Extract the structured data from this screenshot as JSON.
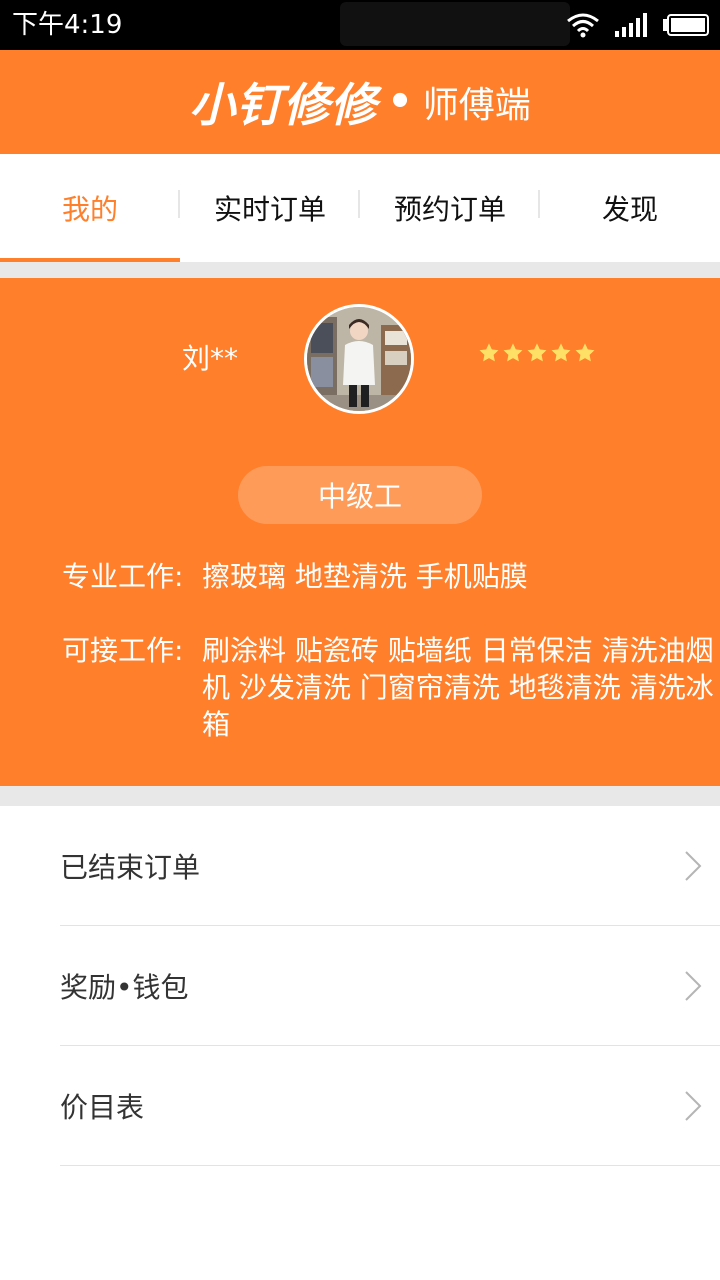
{
  "status_bar": {
    "time": "下午4:19"
  },
  "header": {
    "brand_main": "小钉修修",
    "brand_dot": "•",
    "brand_sub": "师傅端"
  },
  "tabs": [
    {
      "label": "我的",
      "active": true
    },
    {
      "label": "实时订单",
      "active": false
    },
    {
      "label": "预约订单",
      "active": false
    },
    {
      "label": "发现",
      "active": false
    }
  ],
  "profile": {
    "name": "刘**",
    "rating_stars": 5,
    "level": "中级工",
    "specialty_label": "专业工作:",
    "specialty_value": "擦玻璃 地垫清洗 手机贴膜",
    "available_label": "可接工作:",
    "available_value": "刷涂料 贴瓷砖 贴墙纸 日常保洁 清洗油烟机 沙发清洗 门窗帘清洗 地毯清洗 清洗冰箱"
  },
  "menu": [
    {
      "label": "已结束订单"
    },
    {
      "label": "奖励•钱包"
    },
    {
      "label": "价目表"
    }
  ],
  "colors": {
    "accent": "#ff7f2a",
    "star": "#ffe066",
    "divider": "#e8e8e8"
  },
  "icons": {
    "status": [
      "wifi-icon",
      "signal-icon",
      "battery-icon"
    ],
    "rating": "star-icon",
    "menu": "chevron-right-icon"
  }
}
